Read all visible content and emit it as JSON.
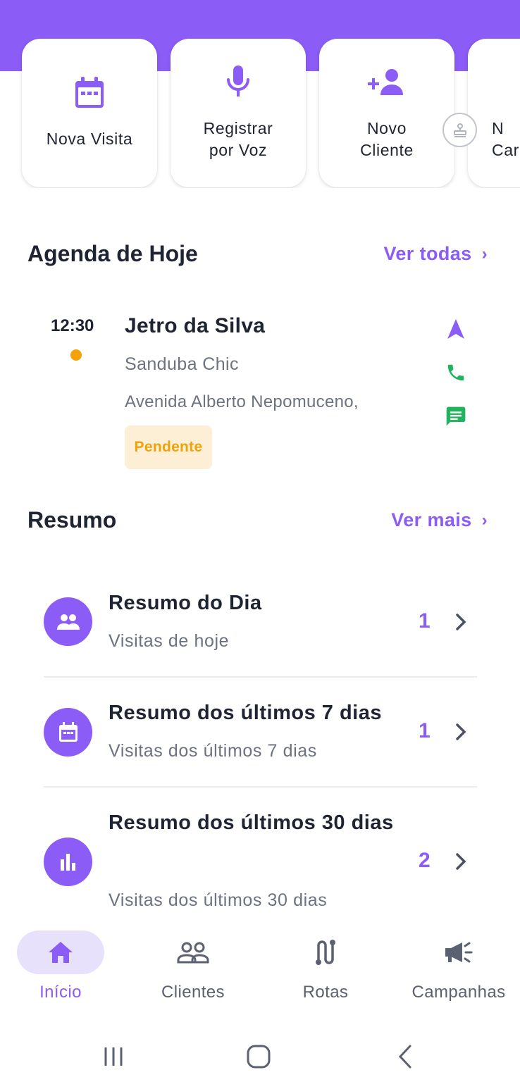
{
  "quick_actions": [
    {
      "label": "Nova Visita",
      "icon": "calendar-icon"
    },
    {
      "label": "Registrar\npor Voz",
      "icon": "microphone-icon"
    },
    {
      "label": "Novo\nCliente",
      "icon": "person-add-icon"
    },
    {
      "label": "N\nCar",
      "icon": "campaign-icon"
    }
  ],
  "agenda": {
    "title": "Agenda de Hoje",
    "link": "Ver todas",
    "appointment": {
      "time": "12:30",
      "name": "Jetro da Silva",
      "company": "Sanduba Chic",
      "address": "Avenida Alberto Nepomuceno,",
      "status": "Pendente"
    }
  },
  "summary": {
    "title": "Resumo",
    "link": "Ver mais",
    "items": [
      {
        "title": "Resumo do Dia",
        "subtitle": "Visitas de hoje",
        "count": "1",
        "icon": "people-icon"
      },
      {
        "title": "Resumo dos últimos 7 dias",
        "subtitle": "Visitas dos últimos 7 dias",
        "count": "1",
        "icon": "calendar-icon"
      },
      {
        "title": "Resumo dos últimos 30 dias",
        "subtitle": "Visitas dos últimos 30 dias",
        "count": "2",
        "icon": "bar-chart-icon"
      }
    ]
  },
  "bottom_nav": [
    {
      "label": "Início",
      "icon": "home-icon",
      "active": true
    },
    {
      "label": "Clientes",
      "icon": "people-outline-icon",
      "active": false
    },
    {
      "label": "Rotas",
      "icon": "route-icon",
      "active": false
    },
    {
      "label": "Campanhas",
      "icon": "megaphone-icon",
      "active": false
    }
  ],
  "colors": {
    "accent": "#8b5cf6",
    "pending": "#f5a20a",
    "pending_bg": "#fdefd6",
    "phone_green": "#22b35e",
    "text_dark": "#1f2433",
    "text_muted": "#6b7280"
  }
}
